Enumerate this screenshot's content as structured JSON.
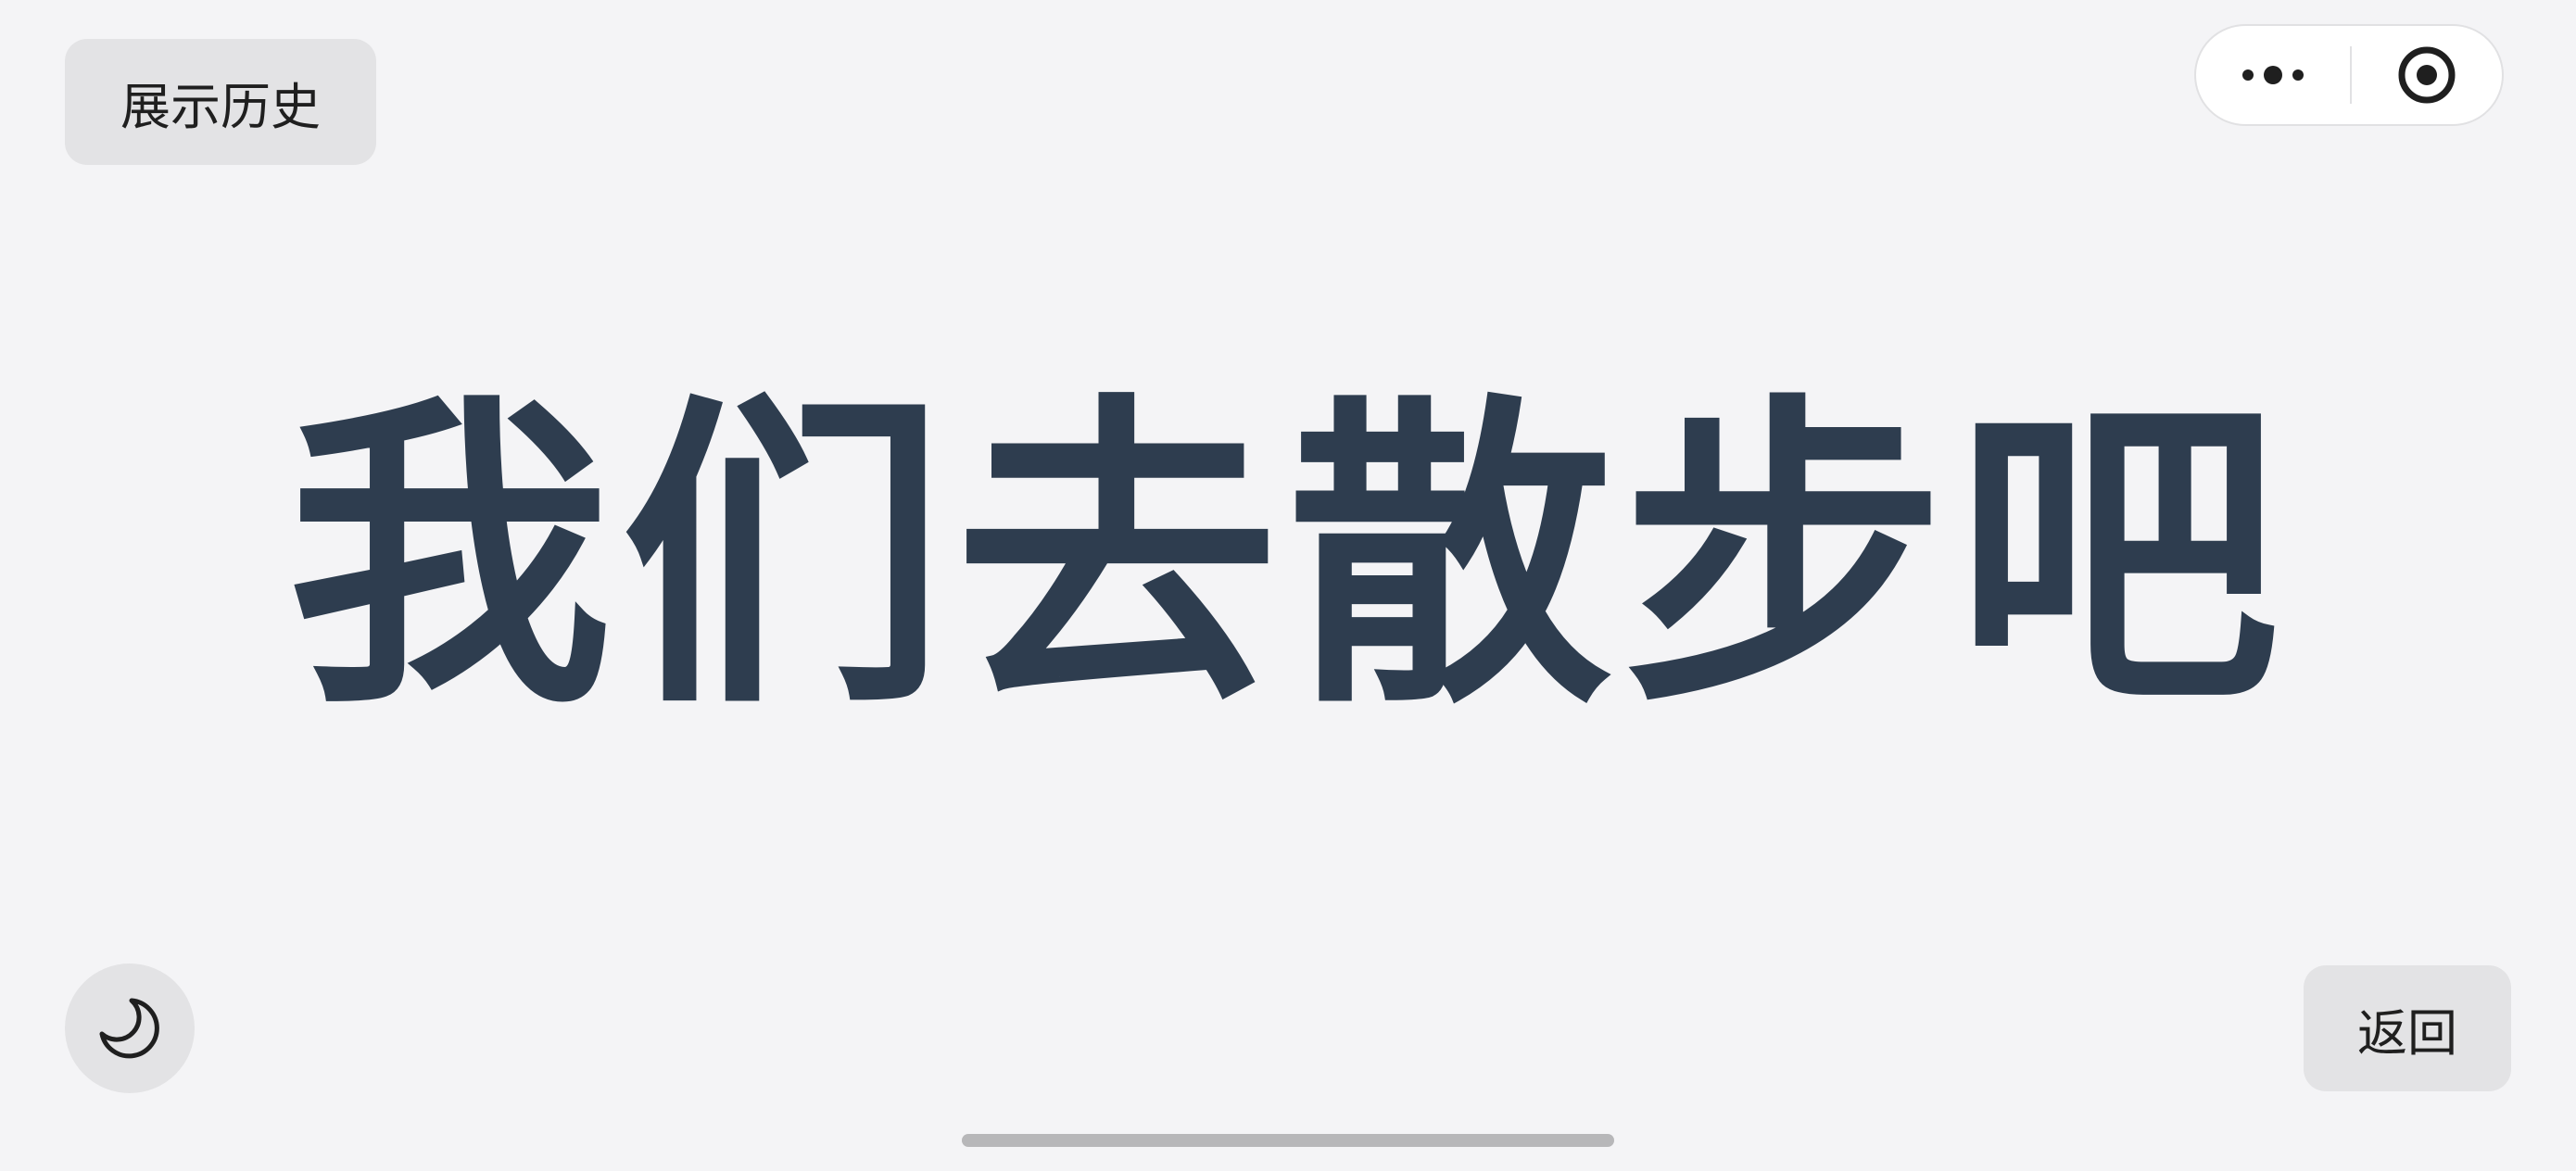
{
  "buttons": {
    "history_label": "展示历史",
    "back_label": "返回"
  },
  "display": {
    "text": "我们去散步吧"
  },
  "icons": {
    "more": "more-dots-icon",
    "close": "target-circle-icon",
    "theme": "moon-icon"
  },
  "colors": {
    "background": "#f4f4f6",
    "text": "#2e3d4f",
    "button_bg": "#e3e3e5"
  }
}
